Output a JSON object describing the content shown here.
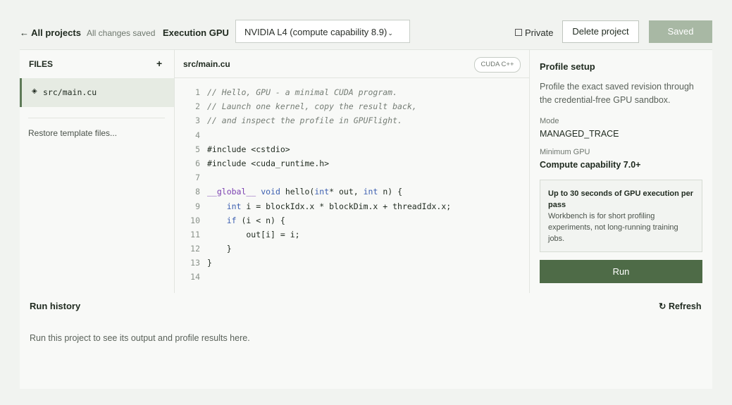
{
  "header": {
    "back_label": "← All projects",
    "save_status": "All changes saved",
    "gpu_label": "Execution GPU",
    "gpu_selected": "NVIDIA L4 (compute capability 8.9)",
    "private_label": "Private",
    "delete_label": "Delete project",
    "saved_label": "Saved"
  },
  "files": {
    "heading": "FILES",
    "add_label": "+",
    "items": [
      {
        "icon": "◈",
        "name": "src/main.cu"
      }
    ],
    "restore_label": "Restore template files..."
  },
  "editor": {
    "title": "src/main.cu",
    "language": "CUDA C++",
    "lines": [
      {
        "n": "1",
        "text": "// Hello, GPU - a minimal CUDA program."
      },
      {
        "n": "2",
        "text": "// Launch one kernel, copy the result back,"
      },
      {
        "n": "3",
        "text": "// and inspect the profile in GPUFlight."
      },
      {
        "n": "4",
        "text": ""
      },
      {
        "n": "5",
        "text": "#include <cstdio>"
      },
      {
        "n": "6",
        "text": "#include <cuda_runtime.h>"
      },
      {
        "n": "7",
        "text": ""
      },
      {
        "n": "8",
        "text": "__global__ void hello(int* out, int n) {"
      },
      {
        "n": "9",
        "text": "    int i = blockIdx.x * blockDim.x + threadIdx.x;"
      },
      {
        "n": "10",
        "text": "    if (i < n) {"
      },
      {
        "n": "11",
        "text": "        out[i] = i;"
      },
      {
        "n": "12",
        "text": "    }"
      },
      {
        "n": "13",
        "text": "}"
      },
      {
        "n": "14",
        "text": ""
      }
    ]
  },
  "profile": {
    "title": "Profile setup",
    "description": "Profile the exact saved revision through the credential-free GPU sandbox.",
    "mode_label": "Mode",
    "mode_value": "MANAGED_TRACE",
    "gpu_label": "Minimum GPU",
    "gpu_value": "Compute capability 7.0+",
    "note_title": "Up to 30 seconds of GPU execution per pass",
    "note_body": "Workbench is for short profiling experiments, not long-running training jobs.",
    "run_label": "Run"
  },
  "history": {
    "title": "Run history",
    "refresh_label": "↻ Refresh",
    "empty_text": "Run this project to see its output and profile results here."
  }
}
